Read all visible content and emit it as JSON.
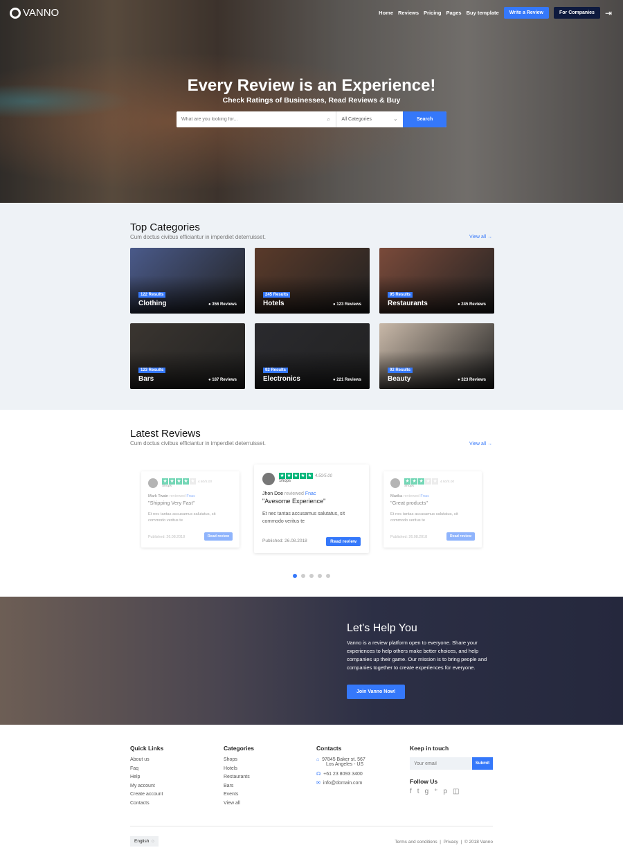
{
  "header": {
    "logo": "VANNO",
    "nav": [
      "Home",
      "Reviews",
      "Pricing",
      "Pages",
      "Buy template"
    ],
    "write_review": "Write a Review",
    "for_companies": "For Companies"
  },
  "hero": {
    "title": "Every Review is an Experience!",
    "subtitle": "Check Ratings of Businesses, Read Reviews & Buy",
    "search_placeholder": "What are you looking for...",
    "category_select": "All Categories",
    "search_button": "Search"
  },
  "categories": {
    "title": "Top Categories",
    "subtitle": "Cum doctus civibus efficiantur in imperdiet deterruisset.",
    "view_all": "View all",
    "items": [
      {
        "name": "Clothing",
        "results": "122 Results",
        "reviews": "356 Reviews",
        "color": "#4a5a8a"
      },
      {
        "name": "Hotels",
        "results": "245 Results",
        "reviews": "123 Reviews",
        "color": "#5a3a2a"
      },
      {
        "name": "Restaurants",
        "results": "95 Results",
        "reviews": "245 Reviews",
        "color": "#7a4a3a"
      },
      {
        "name": "Bars",
        "results": "123 Results",
        "reviews": "187 Reviews",
        "color": "#3a3530"
      },
      {
        "name": "Electronics",
        "results": "92 Results",
        "reviews": "221 Reviews",
        "color": "#2a2a2e"
      },
      {
        "name": "Beauty",
        "results": "92 Results",
        "reviews": "323 Reviews",
        "color": "#c8b8a8"
      }
    ]
  },
  "reviews": {
    "title": "Latest Reviews",
    "subtitle": "Cum doctus civibus efficiantur in imperdiet deterruisset.",
    "view_all": "View all",
    "items": [
      {
        "user": "Mark Twain",
        "reviewed": "reviewed",
        "company": "Fnac",
        "rating_text": "4.50/5.00",
        "stars": 4,
        "category": "Shops",
        "title": "\"Shipping Very Fast\"",
        "body": "Et nec tantas accusamus salutatus, sit commodo veritus te",
        "published": "Published: 26.08.2018",
        "button": "Read review"
      },
      {
        "user": "Jhon Doe",
        "reviewed": "reviewed",
        "company": "Fnac",
        "rating_text": "4.50/5.00",
        "stars": 5,
        "category": "Shops",
        "title": "\"Avesome Experience\"",
        "body": "Et nec tantas accusamus salutatus, sit commodo veritus te",
        "published": "Published: 26.08.2018",
        "button": "Read review"
      },
      {
        "user": "Marika",
        "reviewed": "reviewed",
        "company": "Fnac",
        "rating_text": "4.50/5.00",
        "stars": 3,
        "category": "Shops",
        "title": "\"Great products\"",
        "body": "Et nec tantas accusamus salutatus, sit commodo veritus te",
        "published": "Published: 26.08.2018",
        "button": "Read review"
      }
    ],
    "carousel_active": 1,
    "carousel_count": 5
  },
  "help": {
    "title": "Let's Help You",
    "body": "Vanno is a review platform open to everyone. Share your experiences to help others make better choices, and help companies up their game. Our mission is to bring people and companies together to create experiences for everyone.",
    "button": "Join Vanno Now!"
  },
  "footer": {
    "quick_title": "Quick Links",
    "quick": [
      "About us",
      "Faq",
      "Help",
      "My account",
      "Create account",
      "Contacts"
    ],
    "cat_title": "Categories",
    "cats": [
      "Shops",
      "Hotels",
      "Restaurants",
      "Bars",
      "Events",
      "View all"
    ],
    "contacts_title": "Contacts",
    "address1": "97845 Baker st. 567",
    "address2": "Los Angeles - US",
    "phone": "+61 23 8093 3400",
    "email": "info@domain.com",
    "keep_title": "Keep in touch",
    "email_placeholder": "Your email",
    "submit": "Submit",
    "follow": "Follow Us",
    "language": "English",
    "terms": "Terms and conditions",
    "privacy": "Privacy",
    "copyright": "© 2018 Vanno"
  },
  "colors": {
    "accent": "#3578fa",
    "navy": "#0e1a3e",
    "star": "#00b67a"
  }
}
